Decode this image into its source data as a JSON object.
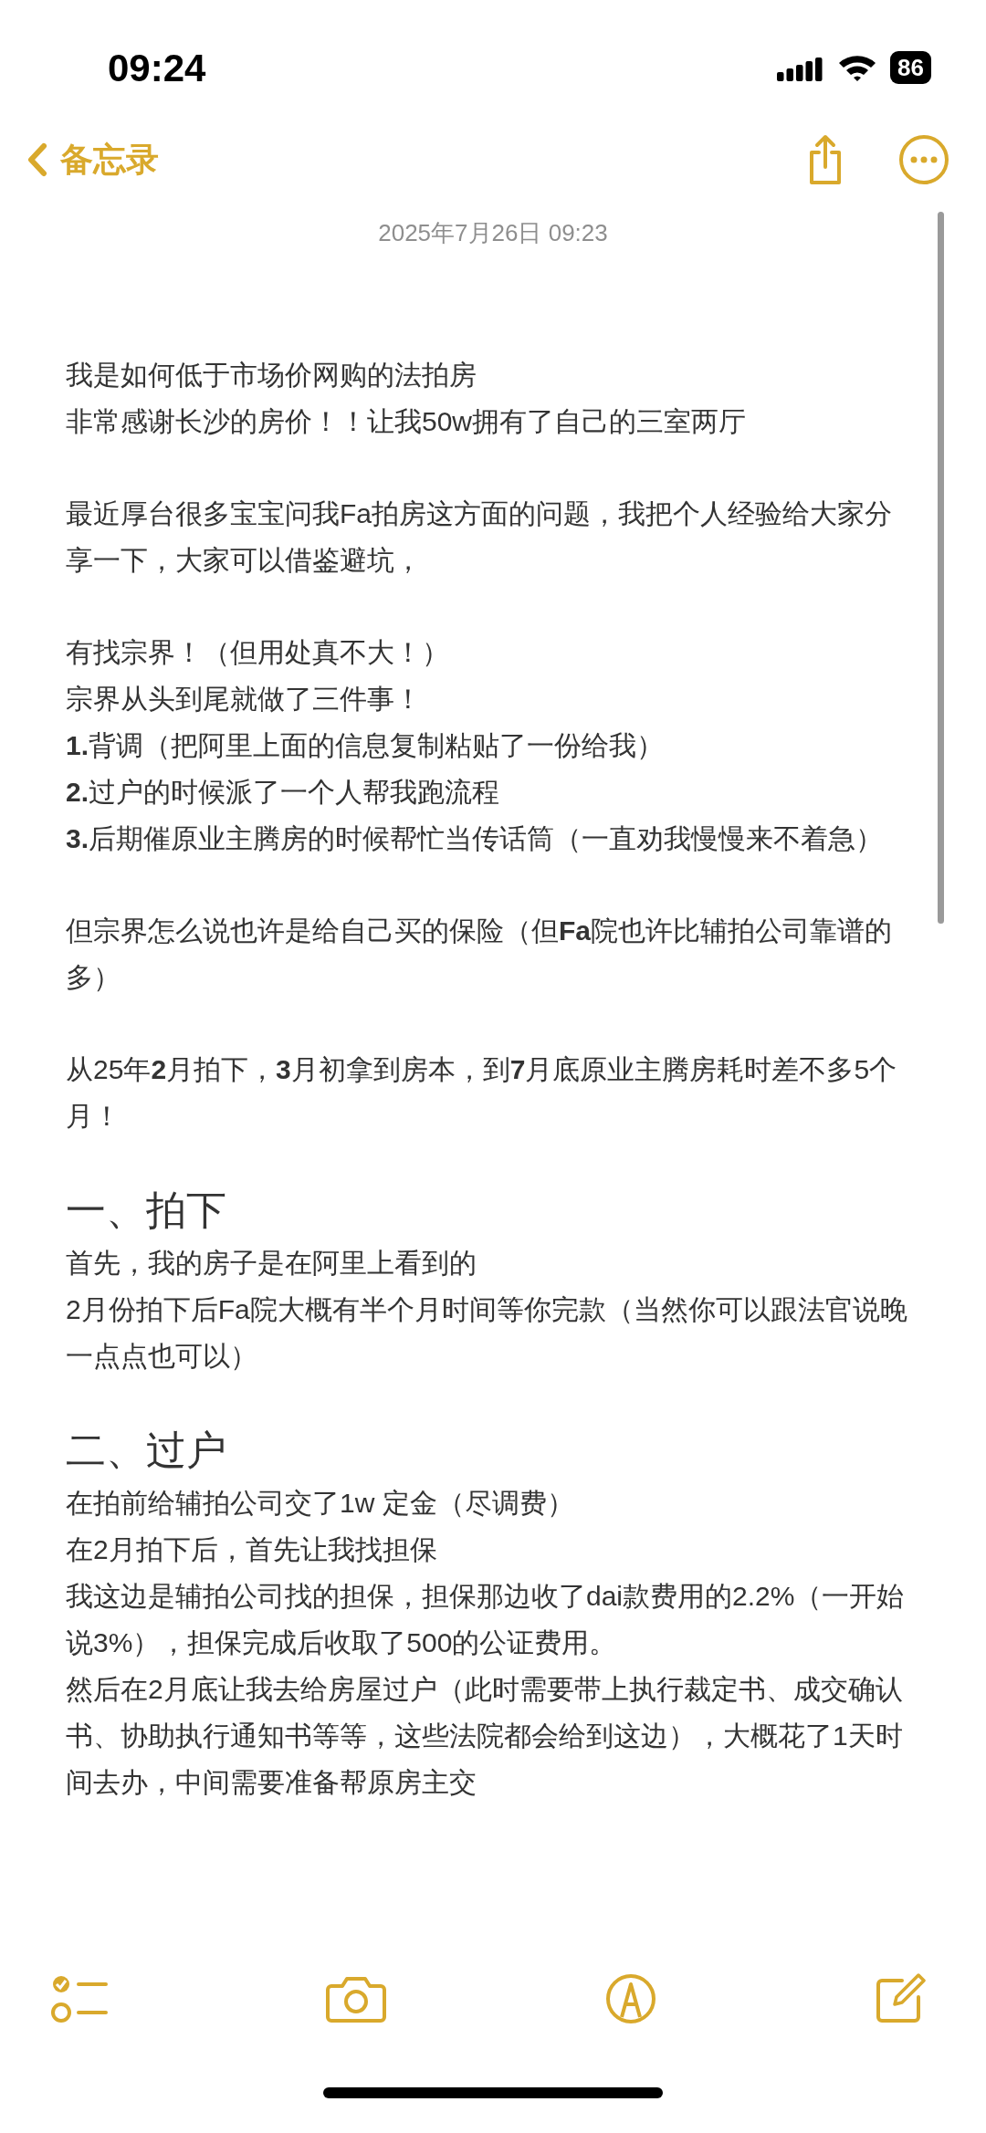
{
  "status_bar": {
    "time": "09:24",
    "battery": "86"
  },
  "nav": {
    "back_label": "备忘录"
  },
  "note": {
    "date": "2025年7月26日 09:23",
    "blocks": [
      {
        "kind": "paragraph",
        "lines": [
          "我是如何低于市场价网购的法拍房",
          "非常感谢长沙的房价！！让我50w拥有了自己的三室两厅"
        ]
      },
      {
        "kind": "paragraph",
        "lines": [
          "最近厚台很多宝宝问我Fa拍房这方面的问题，我把个人经验给大家分享一下，大家可以借鉴避坑，"
        ]
      },
      {
        "kind": "paragraph",
        "lines": [
          "有找宗界！（但用处真不大！）",
          "宗界从头到尾就做了三件事！",
          "**1.**背调（把阿里上面的信息复制粘贴了一份给我）",
          "**2.**过户的时候派了一个人帮我跑流程",
          "**3.**后期催原业主腾房的时候帮忙当传话筒（一直劝我慢慢来不着急）"
        ]
      },
      {
        "kind": "paragraph",
        "lines": [
          "但宗界怎么说也许是给自己买的保险（但**Fa**院也许比辅拍公司靠谱的多）"
        ]
      },
      {
        "kind": "paragraph",
        "lines": [
          "从25年**2**月拍下，**3**月初拿到房本，到**7**月底原业主腾房耗时差不多5个月！"
        ]
      },
      {
        "kind": "heading",
        "text": "一、拍下"
      },
      {
        "kind": "paragraph",
        "lines": [
          "首先，我的房子是在阿里上看到的",
          "2月份拍下后Fa院大概有半个月时间等你完款（当然你可以跟法官说晚一点点也可以）"
        ]
      },
      {
        "kind": "heading",
        "text": "二、过户"
      },
      {
        "kind": "paragraph",
        "lines": [
          "在拍前给辅拍公司交了1w 定金（尽调费）",
          "在2月拍下后，首先让我找担保",
          "我这边是辅拍公司找的担保，担保那边收了dai款费用的2.2%（一开始说3%），担保完成后收取了500的公证费用。",
          "然后在2月底让我去给房屋过户（此时需要带上执行裁定书、成交确认书、协助执行通知书等等，这些法院都会给到这边），大概花了1天时间去办，中间需要准备帮原房主交"
        ]
      }
    ]
  }
}
